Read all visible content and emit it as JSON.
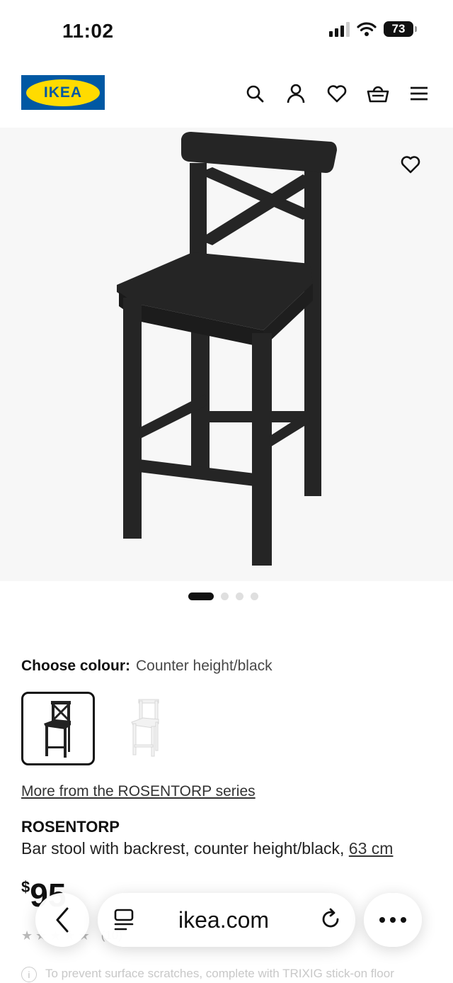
{
  "status_bar": {
    "time": "11:02",
    "battery": "73"
  },
  "header": {
    "logo_text": "IKEA"
  },
  "colors": {
    "ikea_blue": "#0058a3",
    "ikea_yellow": "#ffdb00"
  },
  "gallery": {
    "image_count": 4,
    "active_index": 0
  },
  "colour_selector": {
    "label": "Choose colour:",
    "value": "Counter height/black"
  },
  "series_link": "More from the ROSENTORP series",
  "product": {
    "name": "ROSENTORP",
    "description": "Bar stool with backrest, counter height/black,",
    "size": "63 cm",
    "currency": "$",
    "price": "95"
  },
  "rating": {
    "count": "(10)"
  },
  "notice": "To prevent surface scratches, complete with TRIXIG stick-on floor",
  "browser": {
    "url": "ikea.com"
  }
}
